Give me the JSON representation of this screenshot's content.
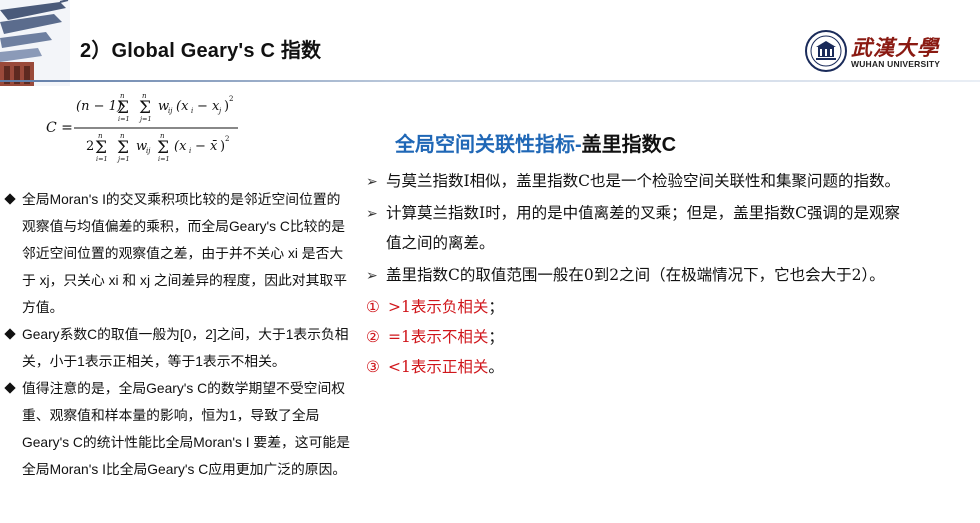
{
  "header": {
    "title": "2）Global Geary's C 指数",
    "logo": {
      "cn": "武漢大學",
      "en": "WUHAN UNIVERSITY"
    }
  },
  "formula": {
    "lhs": "C =",
    "num_prefix": "(n − 1)",
    "num_term": "w",
    "num_diff": "(x",
    "denom_prefix": "2",
    "denom_diff": "(x",
    "sup2": "2",
    "sum_top": "n",
    "sum_i": "i=1",
    "sum_j": "j=1"
  },
  "left": {
    "bullets": [
      "全局Moran's I的交叉乘积项比较的是邻近空间位置的观察值与均值偏差的乘积，而全局Geary's C比较的是邻近空间位置的观察值之差，由于并不关心 xi 是否大于 xj，只关心 xi 和 xj 之间差异的程度，因此对其取平方值。",
      "Geary系数C的取值一般为[0，2]之间，大于1表示负相关，小于1表示正相关，等于1表示不相关。",
      "值得注意的是，全局Geary's C的数学期望不受空间权重、观察值和样本量的影响，恒为1，导致了全局Geary's C的统计性能比全局Moran's I 要差，这可能是全局Moran's I比全局Geary's C应用更加广泛的原因。"
    ]
  },
  "right": {
    "heading_blue": "全局空间关联性指标-",
    "heading_black": "盖里指数C",
    "bullets": [
      "与莫兰指数I相似，盖里指数C也是一个检验空间关联性和集聚问题的指数。",
      "计算莫兰指数I时，用的是中值离差的叉乘；但是，盖里指数C强调的是观察",
      "值之间的离差。",
      "盖里指数C的取值范围一般在0到2之间（在极端情况下，它也会大于2）。"
    ],
    "items": [
      {
        "num": "①",
        "sym": ">1表示",
        "value": "负相关",
        "end": "；"
      },
      {
        "num": "②",
        "sym": "=1表示",
        "value": "不相关",
        "end": "；"
      },
      {
        "num": "③",
        "sym": "<1表示",
        "value": "正相关",
        "end": "。"
      }
    ]
  },
  "colors": {
    "accent_blue": "#1f67b6",
    "emphasis_red": "#d0161b",
    "logo_red": "#8a1a12"
  }
}
